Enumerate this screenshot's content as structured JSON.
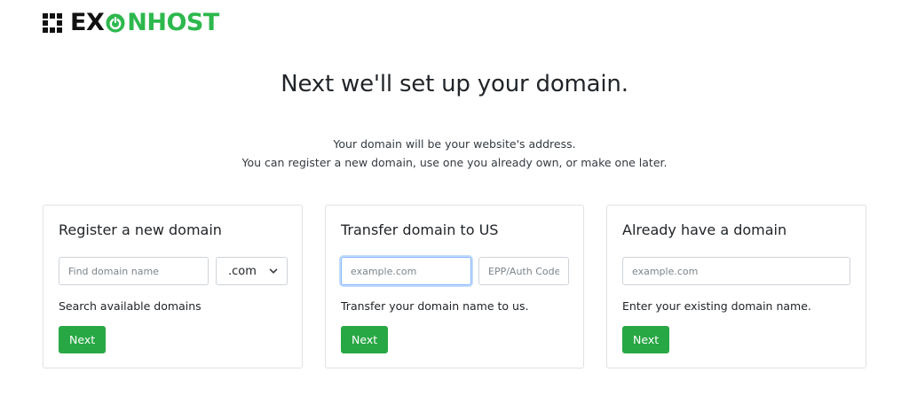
{
  "brand": {
    "part1": "EX",
    "part2": "NHOST",
    "icon": "power-icon",
    "accent_color": "#2db84d"
  },
  "header": {
    "title": "Next we'll set up your domain.",
    "subtitle_line1": "Your domain will be your website's address.",
    "subtitle_line2": "You can register a new domain, use one you already own, or make one later."
  },
  "cards": {
    "register": {
      "title": "Register a new domain",
      "input_placeholder": "Find domain name",
      "input_value": "",
      "tld_selected": ".com",
      "help": "Search available domains",
      "button": "Next"
    },
    "transfer": {
      "title": "Transfer domain to US",
      "domain_placeholder": "example.com",
      "domain_value": "",
      "epp_placeholder": "EPP/Auth Code",
      "epp_value": "",
      "help": "Transfer your domain name to us.",
      "button": "Next"
    },
    "existing": {
      "title": "Already have a domain",
      "domain_placeholder": "example.com",
      "domain_value": "",
      "help": "Enter your existing domain name.",
      "button": "Next"
    }
  },
  "colors": {
    "button_green": "#28a745",
    "focus_border": "#86b7fe"
  }
}
